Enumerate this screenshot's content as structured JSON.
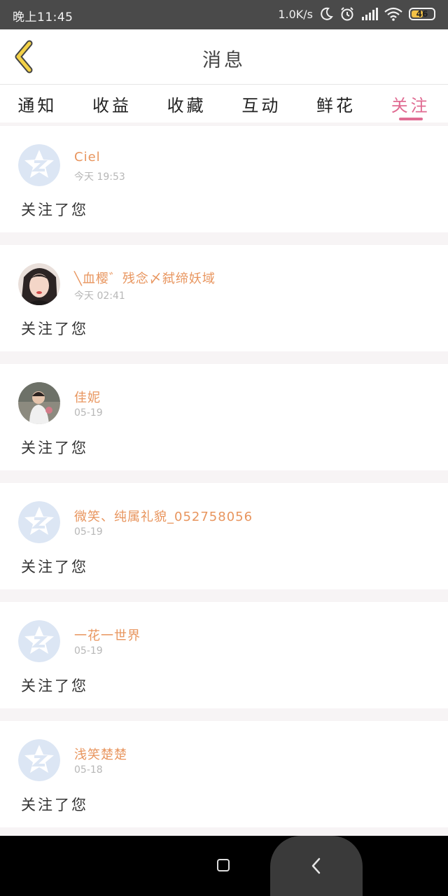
{
  "status_bar": {
    "time": "晚上11:45",
    "speed": "1.0K/s",
    "battery": "46",
    "battery_level_fraction": 0.46,
    "icons": [
      "moon-icon",
      "alarm-icon",
      "signal-icon",
      "wifi-icon",
      "battery-icon"
    ]
  },
  "header": {
    "title": "消息",
    "back_icon": "chevron-left-icon",
    "accent_color": "#f3d147"
  },
  "tabs": [
    {
      "label": "通知",
      "active": false
    },
    {
      "label": "收益",
      "active": false
    },
    {
      "label": "收藏",
      "active": false
    },
    {
      "label": "互动",
      "active": false
    },
    {
      "label": "鲜花",
      "active": false
    },
    {
      "label": "关注",
      "active": true
    }
  ],
  "colors": {
    "active_tab": "#e06b92",
    "username": "#e8955e",
    "timestamp": "#b7b7b7",
    "default_avatar": "#dce6f4"
  },
  "notifications": [
    {
      "username": "Ciel",
      "time": "今天 19:53",
      "message": "关注了您",
      "avatar": "default-avatar"
    },
    {
      "username": "╲血樱゛残念〆弑缔妖域",
      "time": "今天 02:41",
      "message": "关注了您",
      "avatar": "photo-avatar-woman"
    },
    {
      "username": "佳妮",
      "time": "05-19",
      "message": "关注了您",
      "avatar": "photo-avatar-child"
    },
    {
      "username": "微笑、纯属礼貌_052758056",
      "time": "05-19",
      "message": "关注了您",
      "avatar": "default-avatar"
    },
    {
      "username": "一花一世界",
      "time": "05-19",
      "message": "关注了您",
      "avatar": "default-avatar"
    },
    {
      "username": "浅笑楚楚",
      "time": "05-18",
      "message": "关注了您",
      "avatar": "default-avatar"
    }
  ],
  "nav_bar": {
    "icons": [
      "home-square-icon",
      "back-arrow-icon"
    ]
  }
}
